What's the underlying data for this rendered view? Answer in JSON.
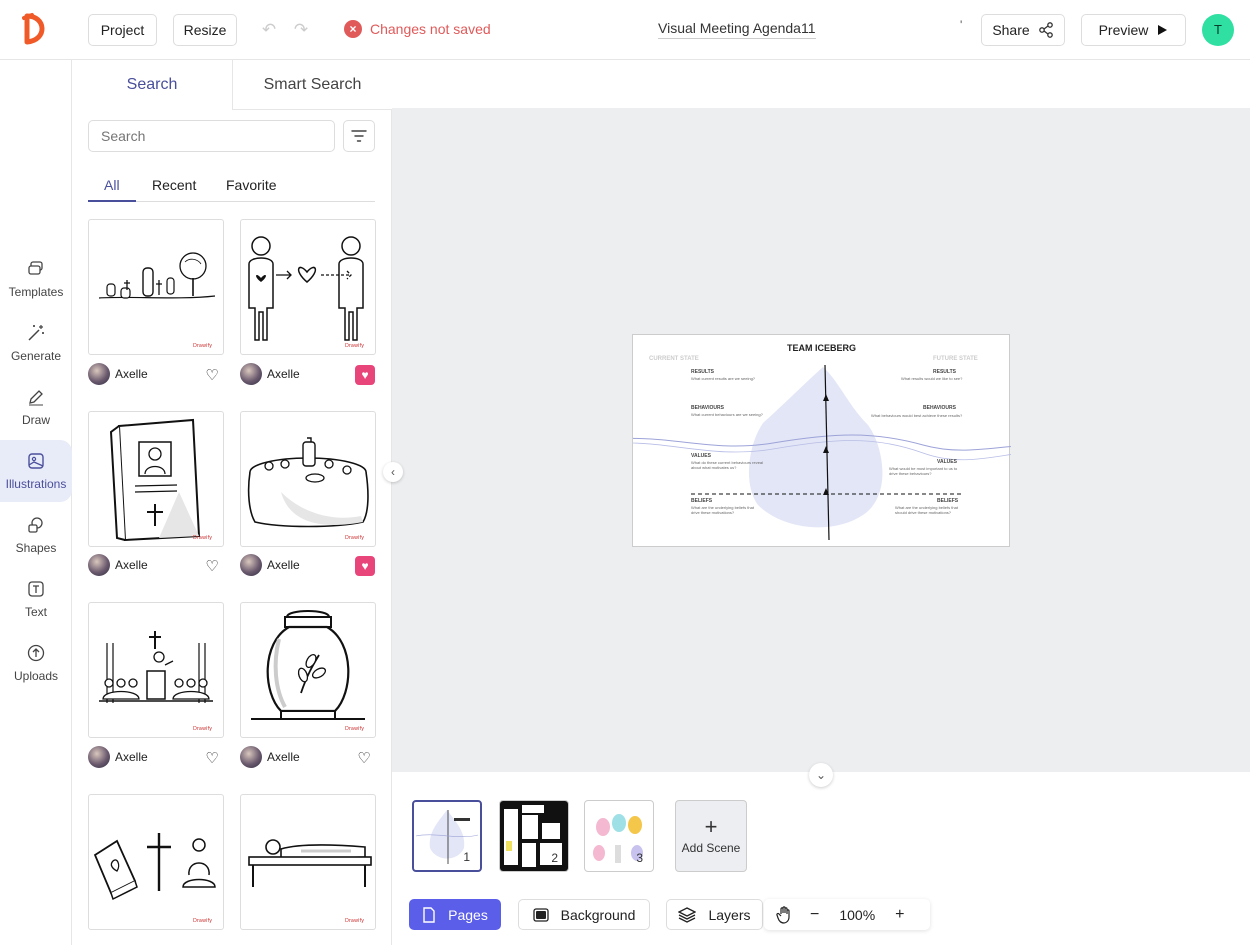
{
  "topbar": {
    "project_label": "Project",
    "resize_label": "Resize",
    "status_text": "Changes not saved",
    "doc_title": "Visual Meeting Agenda11",
    "tick": "'",
    "share_label": "Share",
    "preview_label": "Preview",
    "avatar_initial": "T"
  },
  "rail": {
    "items": [
      {
        "label": "Templates",
        "icon": "templates-icon"
      },
      {
        "label": "Generate",
        "icon": "magic-wand-icon"
      },
      {
        "label": "Draw",
        "icon": "pencil-icon"
      },
      {
        "label": "Illustrations",
        "icon": "image-icon"
      },
      {
        "label": "Shapes",
        "icon": "shapes-icon"
      },
      {
        "label": "Text",
        "icon": "text-icon"
      },
      {
        "label": "Uploads",
        "icon": "upload-icon"
      }
    ],
    "active": "Illustrations"
  },
  "panel": {
    "tabs": [
      "Search",
      "Smart Search"
    ],
    "search_placeholder": "Search",
    "subtabs": [
      "All",
      "Recent",
      "Favorite"
    ],
    "cards": [
      {
        "subject": "cemetery",
        "author": "Axelle",
        "favorite": false
      },
      {
        "subject": "heart-transfer",
        "author": "Axelle",
        "favorite": true
      },
      {
        "subject": "funeral-card",
        "author": "Axelle",
        "favorite": false
      },
      {
        "subject": "table-setting",
        "author": "Axelle",
        "favorite": true
      },
      {
        "subject": "church-service",
        "author": "Axelle",
        "favorite": false
      },
      {
        "subject": "urn",
        "author": "Axelle",
        "favorite": false
      },
      {
        "subject": "religion-symbols",
        "author": "Axelle",
        "favorite": false
      },
      {
        "subject": "lying-person",
        "author": "Axelle",
        "favorite": false
      }
    ]
  },
  "slide": {
    "title": "TEAM ICEBERG",
    "current_state": "CURRENT STATE",
    "future_state": "FUTURE STATE",
    "left_labels": [
      "RESULTS",
      "BEHAVIOURS",
      "VALUES",
      "BELIEFS"
    ],
    "right_labels": [
      "RESULTS",
      "BEHAVIOURS",
      "VALUES",
      "BELIEFS"
    ],
    "left_subs": [
      "What current results are we seeing?",
      "What current behaviours are we seeing?",
      "What do these current behaviours reveal about what motivates us?",
      "What are the underlying beliefs that drive these motivations?"
    ],
    "right_subs": [
      "What results would we like to see?",
      "What behaviours would best achieve these results?",
      "What would be most important to us to drive these behaviours?",
      "What are the underlying beliefs that should drive these motivations?"
    ]
  },
  "scenes": {
    "thumbs": [
      "1",
      "2",
      "3"
    ],
    "add_label": "Add Scene"
  },
  "bottom": {
    "pages_label": "Pages",
    "background_label": "Background",
    "layers_label": "Layers",
    "zoom_minus": "−",
    "zoom_value": "100%",
    "zoom_plus": "+"
  },
  "colors": {
    "accent": "#5a5ee8",
    "accent_dark": "#4a4f9c",
    "error": "#e05a5a",
    "favorite": "#e8457a",
    "avatar": "#2fe0a2",
    "logo": "#f05a28"
  }
}
